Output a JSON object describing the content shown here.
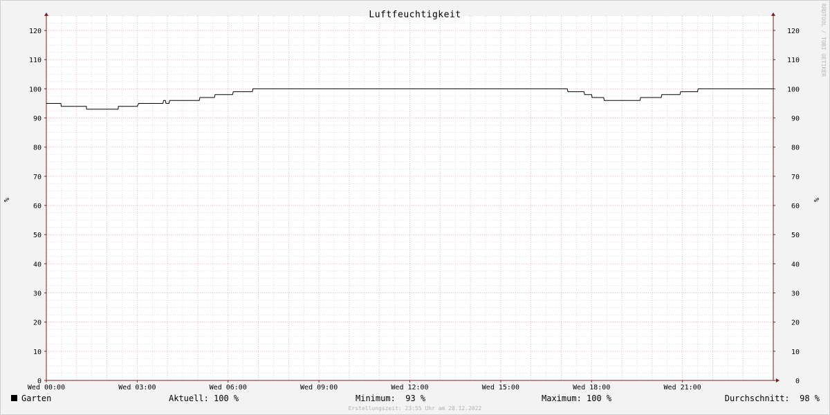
{
  "chart_data": {
    "type": "line",
    "title": "Luftfeuchtigkeit",
    "ylabel": "%",
    "ylim": [
      0,
      125
    ],
    "y_ticks": [
      0,
      10,
      20,
      30,
      40,
      50,
      60,
      70,
      80,
      90,
      100,
      110,
      120
    ],
    "x_range_hours": [
      0,
      24
    ],
    "x_ticks": [
      {
        "hour": 0,
        "label": "Wed 00:00"
      },
      {
        "hour": 3,
        "label": "Wed 03:00"
      },
      {
        "hour": 6,
        "label": "Wed 06:00"
      },
      {
        "hour": 9,
        "label": "Wed 09:00"
      },
      {
        "hour": 12,
        "label": "Wed 12:00"
      },
      {
        "hour": 15,
        "label": "Wed 15:00"
      },
      {
        "hour": 18,
        "label": "Wed 18:00"
      },
      {
        "hour": 21,
        "label": "Wed 21:00"
      }
    ],
    "grid": true,
    "series": [
      {
        "name": "Garten",
        "color": "#000000",
        "x": [
          0,
          0.48,
          0.49,
          1.32,
          1.33,
          2.37,
          2.38,
          3.0,
          3.05,
          3.85,
          3.87,
          3.93,
          3.95,
          4.05,
          4.07,
          5.05,
          5.07,
          5.55,
          5.57,
          6.15,
          6.17,
          6.8,
          6.82,
          17.2,
          17.22,
          17.75,
          17.77,
          18.0,
          18.02,
          18.4,
          18.42,
          19.6,
          19.62,
          20.3,
          20.32,
          20.92,
          20.94,
          21.5,
          21.52,
          24.0
        ],
        "y": [
          95,
          95,
          94,
          94,
          93,
          93,
          94,
          94,
          95,
          95,
          96,
          96,
          95,
          95,
          96,
          96,
          97,
          97,
          98,
          98,
          99,
          99,
          100,
          100,
          99,
          99,
          98,
          98,
          97,
          97,
          96,
          96,
          97,
          97,
          98,
          98,
          99,
          99,
          100,
          100
        ]
      }
    ],
    "legend": "bottom-left"
  },
  "legend": {
    "series_name": "Garten",
    "series_color": "#000000",
    "current": "Aktuell: 100 %",
    "minimum": "Minimum:  93 %",
    "maximum": "Maximum: 100 %",
    "average": "Durchschnitt:  98 %"
  },
  "footer": "Erstellungszeit: 23:55 Uhr am 28.12.2022",
  "watermark": "RRDTOOL / TOBI OETIKER",
  "colors": {
    "major_grid": "#e8a0a8",
    "minor_grid": "#c9c9c9",
    "axis": "#7a1f1f",
    "plot_bg": "#ffffff"
  }
}
